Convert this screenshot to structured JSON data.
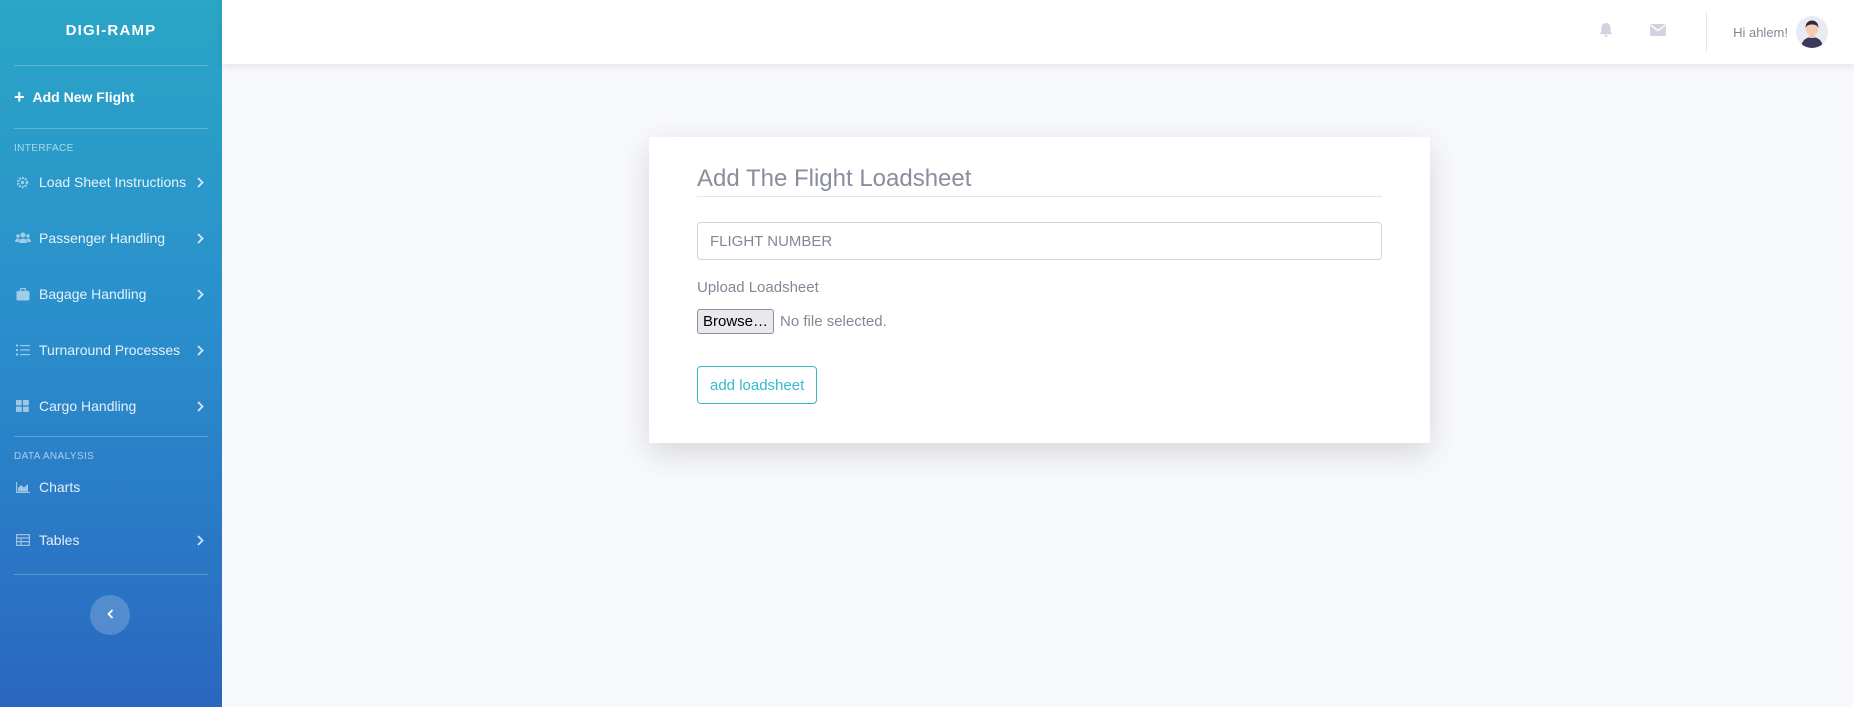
{
  "brand": "DIGI-RAMP",
  "sidebar": {
    "primary": {
      "label": "Add New Flight",
      "icon": "plus-icon"
    },
    "sections": [
      {
        "heading": "INTERFACE",
        "items": [
          {
            "label": "Load Sheet Instructions",
            "icon": "cog-icon"
          },
          {
            "label": "Passenger Handling",
            "icon": "users-icon"
          },
          {
            "label": "Bagage Handling",
            "icon": "suitcase-icon"
          },
          {
            "label": "Turnaround Processes",
            "icon": "list-icon"
          },
          {
            "label": "Cargo Handling",
            "icon": "grid-icon"
          }
        ]
      },
      {
        "heading": "DATA ANALYSIS",
        "items": [
          {
            "label": "Charts",
            "icon": "area-chart-icon"
          },
          {
            "label": "Tables",
            "icon": "table-icon"
          }
        ]
      }
    ],
    "toggle_icon": "chevron-left-icon"
  },
  "topbar": {
    "icons": [
      "bell-icon",
      "envelope-icon"
    ],
    "greeting": "Hi ahlem!"
  },
  "form": {
    "title": "Add The Flight Loadsheet",
    "flight_number_placeholder": "FLIGHT NUMBER",
    "flight_number_value": "",
    "upload_label": "Upload Loadsheet",
    "browse_label": "Browse…",
    "file_status": "No file selected.",
    "submit_label": "add loadsheet"
  },
  "colors": {
    "sidebar_top": "#2aa6c6",
    "sidebar_bottom": "#2a67c0",
    "accent": "#36b9cc",
    "page_bg": "#f8f9fc",
    "muted_text": "#858796"
  }
}
